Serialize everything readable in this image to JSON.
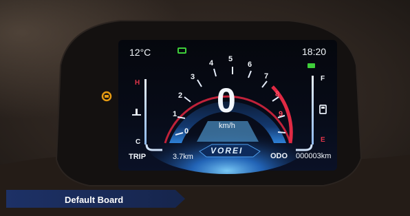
{
  "dashboard": {
    "temperature": "12°C",
    "time": "18:20",
    "speed": "0",
    "speed_unit": "km/h",
    "brand": "VOREI",
    "trip_label": "TRIP",
    "trip_value": "3.7km",
    "odo_label": "ODO",
    "odo_value": "000003km",
    "temp_high_label": "H",
    "temp_low_label": "C",
    "fuel_full_label": "F",
    "fuel_empty_label": "E",
    "tach_ticks": [
      "0",
      "1",
      "2",
      "3",
      "4",
      "5",
      "6",
      "7",
      "8",
      "9"
    ],
    "icons": [
      "battery-icon",
      "coolant-temp-icon",
      "fuel-pump-icon",
      "engine-warning-icon",
      "high-beam-icon"
    ],
    "colors": {
      "tach_red_zone": "#d4243a",
      "indicator_green": "#3fcf3a",
      "warning_amber": "#e59a12",
      "screen_blue": "#2a7fe6",
      "caption_bar": "#1a2b5c"
    }
  },
  "caption": {
    "label": "Default Board"
  }
}
